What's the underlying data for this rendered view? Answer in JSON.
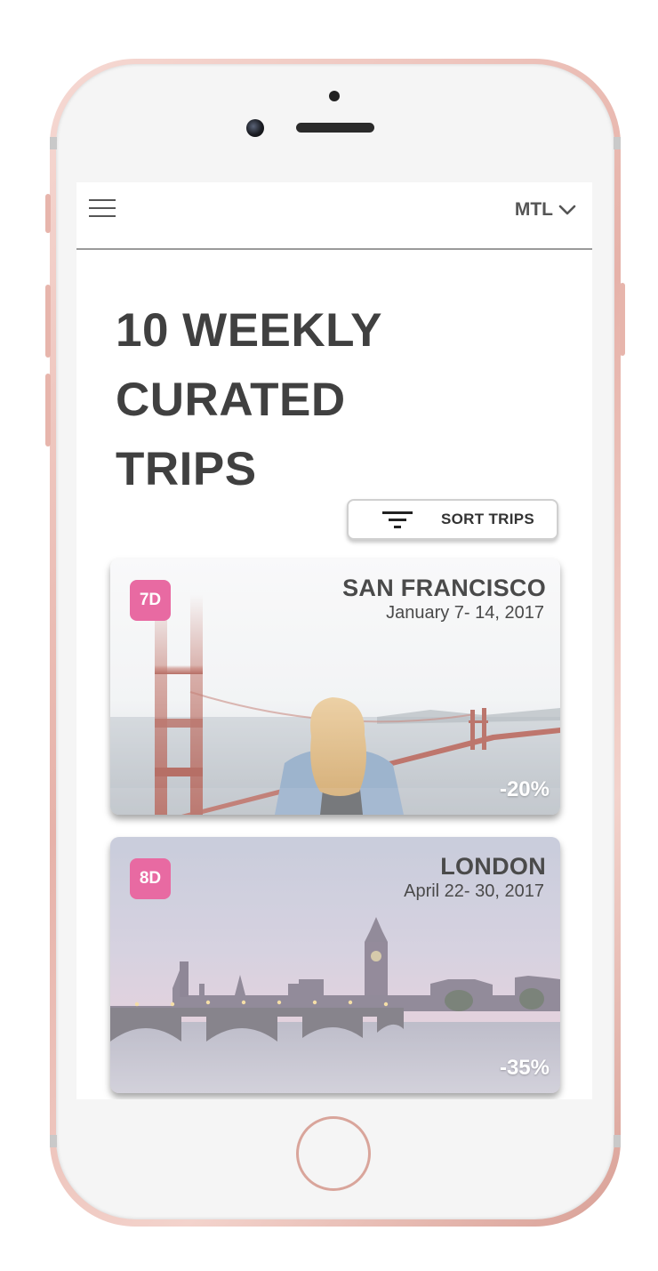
{
  "header": {
    "city_code": "MTL"
  },
  "headline": {
    "lines": [
      "10 WEEKLY",
      "CURATED",
      "TRIPS"
    ]
  },
  "sort": {
    "label": "SORT TRIPS"
  },
  "trips": [
    {
      "badge": "7D",
      "city": "SAN FRANCISCO",
      "dates": "January 7- 14, 2017",
      "discount": "-20%"
    },
    {
      "badge": "8D",
      "city": "LONDON",
      "dates": "April 22- 30, 2017",
      "discount": "-35%"
    }
  ],
  "colors": {
    "badge": "#e86aa2",
    "phone_frame": "#e6b2a9",
    "text_dark": "#404040"
  },
  "icons": {
    "menu": "hamburger-icon",
    "dropdown": "chevron-down-icon",
    "sort": "filter-icon"
  }
}
